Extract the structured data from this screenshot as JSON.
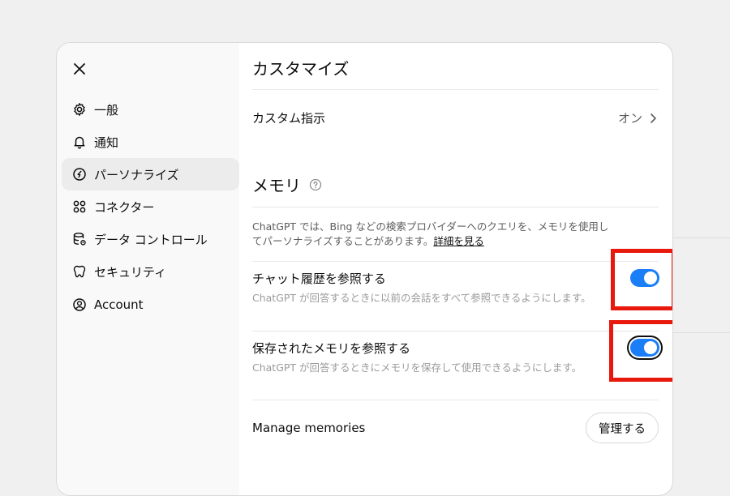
{
  "sidebar": {
    "close_icon": "close-icon",
    "items": [
      {
        "label": "一般",
        "icon": "gear-icon"
      },
      {
        "label": "通知",
        "icon": "bell-icon"
      },
      {
        "label": "パーソナライズ",
        "icon": "personalize-icon",
        "active": true
      },
      {
        "label": "コネクター",
        "icon": "connectors-icon"
      },
      {
        "label": "データ コントロール",
        "icon": "database-gear-icon"
      },
      {
        "label": "セキュリティ",
        "icon": "security-icon"
      },
      {
        "label": "Account",
        "icon": "account-icon"
      }
    ]
  },
  "main": {
    "title": "カスタマイズ",
    "custom_instructions": {
      "label": "カスタム指示",
      "value": "オン"
    },
    "memory": {
      "title": "メモリ",
      "description": "ChatGPT では、Bing などの検索プロバイダーへのクエリを、メモリを使用してパーソナライズすることがあります。",
      "link_text": "詳細を見る",
      "settings": [
        {
          "title": "チャット履歴を参照する",
          "description": "ChatGPT が回答するときに以前の会話をすべて参照できるようにします。",
          "enabled": true
        },
        {
          "title": "保存されたメモリを参照する",
          "description": "ChatGPT が回答するときにメモリを保存して使用できるようにします。",
          "enabled": true
        }
      ],
      "manage": {
        "label": "Manage memories",
        "button_label": "管理する"
      }
    }
  },
  "colors": {
    "toggle_on": "#1a7ef7",
    "highlight": "#e8180c",
    "active_item_bg": "#ececec"
  }
}
